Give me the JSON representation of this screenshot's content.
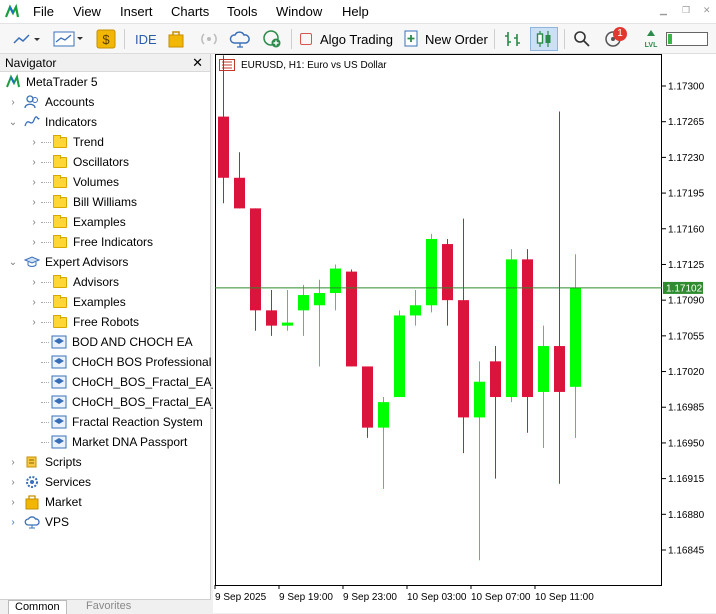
{
  "menu": [
    "File",
    "View",
    "Insert",
    "Charts",
    "Tools",
    "Window",
    "Help"
  ],
  "toolbar": {
    "ide_label": "IDE",
    "algo_trading_label": "Algo Trading",
    "new_order_label": "New Order",
    "notification_count": "1"
  },
  "navigator": {
    "title": "Navigator",
    "root": "MetaTrader 5",
    "items": [
      {
        "label": "Accounts"
      },
      {
        "label": "Indicators"
      },
      {
        "label": "Trend"
      },
      {
        "label": "Oscillators"
      },
      {
        "label": "Volumes"
      },
      {
        "label": "Bill Williams"
      },
      {
        "label": "Examples"
      },
      {
        "label": "Free Indicators"
      },
      {
        "label": "Expert Advisors"
      },
      {
        "label": "Advisors"
      },
      {
        "label": "Examples"
      },
      {
        "label": "Free Robots"
      },
      {
        "label": "BOD AND CHOCH EA"
      },
      {
        "label": "CHoCH BOS Professional I"
      },
      {
        "label": "CHoCH_BOS_Fractal_EA_cl"
      },
      {
        "label": "CHoCH_BOS_Fractal_EA_e"
      },
      {
        "label": "Fractal Reaction System"
      },
      {
        "label": "Market DNA Passport"
      },
      {
        "label": "Scripts"
      },
      {
        "label": "Services"
      },
      {
        "label": "Market"
      },
      {
        "label": "VPS"
      }
    ],
    "tabs": [
      "Common",
      "Favorites"
    ]
  },
  "chart": {
    "title": "EURUSD, H1:  Euro vs US Dollar",
    "current_price": "1.17102",
    "colors": {
      "bull": "#00ff00",
      "bear": "#dc143c",
      "price_line": "#2e8b2e"
    }
  },
  "chart_data": {
    "type": "candlestick",
    "symbol": "EURUSD",
    "timeframe": "H1",
    "title": "EURUSD, H1:  Euro vs US Dollar",
    "ylim": [
      1.1682,
      1.1732
    ],
    "yticks": [
      "1.17300",
      "1.17265",
      "1.17230",
      "1.17195",
      "1.17160",
      "1.17125",
      "1.17090",
      "1.17055",
      "1.17020",
      "1.16985",
      "1.16950",
      "1.16915",
      "1.16880",
      "1.16845"
    ],
    "xticks": [
      "9 Sep 2025",
      "9 Sep 19:00",
      "9 Sep 23:00",
      "10 Sep 03:00",
      "10 Sep 07:00",
      "10 Sep 11:00"
    ],
    "candles": [
      {
        "o": 1.1727,
        "h": 1.1733,
        "l": 1.17185,
        "c": 1.1721
      },
      {
        "o": 1.1721,
        "h": 1.17235,
        "l": 1.1718,
        "c": 1.1718
      },
      {
        "o": 1.1718,
        "h": 1.1718,
        "l": 1.1706,
        "c": 1.1708
      },
      {
        "o": 1.1708,
        "h": 1.171,
        "l": 1.17055,
        "c": 1.17065
      },
      {
        "o": 1.17065,
        "h": 1.171,
        "l": 1.1706,
        "c": 1.17068
      },
      {
        "o": 1.1708,
        "h": 1.17105,
        "l": 1.17055,
        "c": 1.17095
      },
      {
        "o": 1.17085,
        "h": 1.1711,
        "l": 1.17025,
        "c": 1.17097
      },
      {
        "o": 1.17097,
        "h": 1.17125,
        "l": 1.1708,
        "c": 1.17121
      },
      {
        "o": 1.17118,
        "h": 1.1712,
        "l": 1.17025,
        "c": 1.17025
      },
      {
        "o": 1.17025,
        "h": 1.17025,
        "l": 1.16955,
        "c": 1.16965
      },
      {
        "o": 1.16965,
        "h": 1.16995,
        "l": 1.16905,
        "c": 1.1699
      },
      {
        "o": 1.16995,
        "h": 1.1708,
        "l": 1.16995,
        "c": 1.17075
      },
      {
        "o": 1.17075,
        "h": 1.171,
        "l": 1.17065,
        "c": 1.17085
      },
      {
        "o": 1.17085,
        "h": 1.17155,
        "l": 1.17078,
        "c": 1.1715
      },
      {
        "o": 1.17145,
        "h": 1.1715,
        "l": 1.17065,
        "c": 1.1709
      },
      {
        "o": 1.1709,
        "h": 1.1717,
        "l": 1.1694,
        "c": 1.16975
      },
      {
        "o": 1.16975,
        "h": 1.1703,
        "l": 1.16835,
        "c": 1.1701
      },
      {
        "o": 1.1703,
        "h": 1.17045,
        "l": 1.16915,
        "c": 1.16995
      },
      {
        "o": 1.16995,
        "h": 1.1714,
        "l": 1.1699,
        "c": 1.1713
      },
      {
        "o": 1.1713,
        "h": 1.1714,
        "l": 1.1696,
        "c": 1.16995
      },
      {
        "o": 1.17,
        "h": 1.17065,
        "l": 1.16945,
        "c": 1.17045
      },
      {
        "o": 1.17045,
        "h": 1.17275,
        "l": 1.1691,
        "c": 1.17
      },
      {
        "o": 1.17005,
        "h": 1.17135,
        "l": 1.16955,
        "c": 1.17102
      }
    ]
  }
}
